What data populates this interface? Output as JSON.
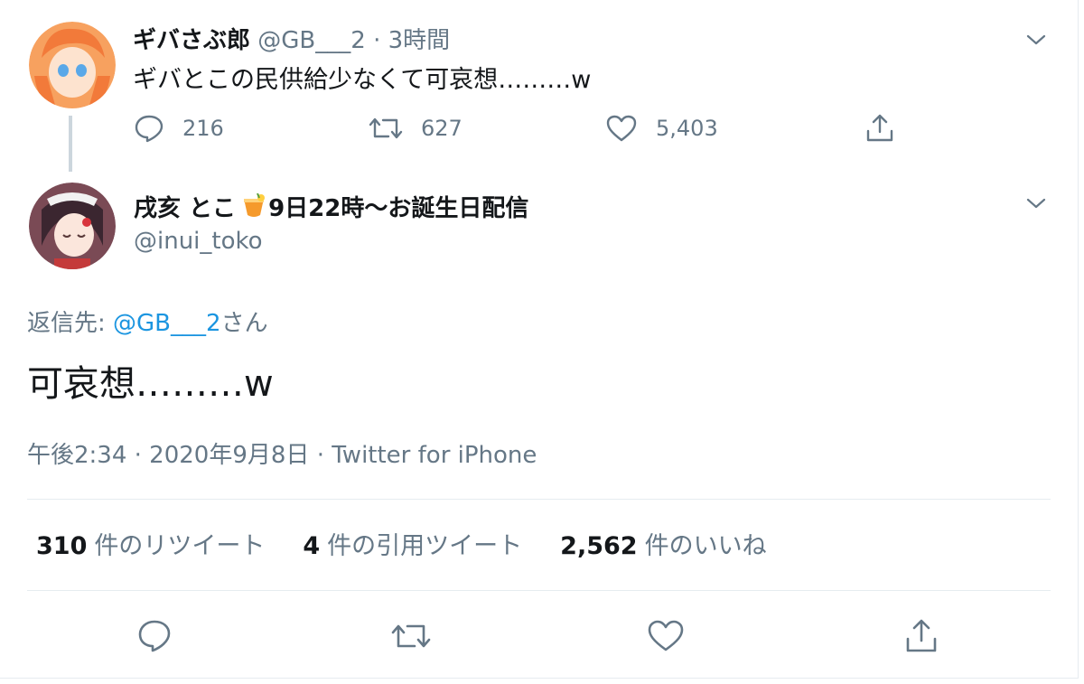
{
  "parent_tweet": {
    "display_name": "ギバさぶ郎",
    "handle": "@GB___2",
    "separator": "·",
    "time": "3時間",
    "text": "ギバとこの民供給少なくて可哀想………w",
    "reply_count": "216",
    "retweet_count": "627",
    "like_count": "5,403"
  },
  "reply_tweet": {
    "display_name_part1": "戌亥 とこ",
    "display_name_part2": "9日22時〜お誕生日配信",
    "handle": "@inui_toko",
    "reply_to_label": "返信先:",
    "reply_to_handle": "@GB___2",
    "reply_to_suffix": "さん",
    "text": "可哀想………w",
    "timestamp": "午後2:34 · 2020年9月8日 · Twitter for iPhone"
  },
  "stats": {
    "retweets_count": "310",
    "retweets_label": "件のリツイート",
    "quotes_count": "4",
    "quotes_label": "件の引用ツイート",
    "likes_count": "2,562",
    "likes_label": "件のいいね"
  },
  "icons": {
    "reply": "reply-icon",
    "retweet": "retweet-icon",
    "like": "heart-icon",
    "share": "share-icon",
    "more": "chevron-down-icon"
  },
  "colors": {
    "link": "#1b95e0",
    "muted": "#657786",
    "text": "#14171a",
    "divider": "#e6ecf0"
  }
}
